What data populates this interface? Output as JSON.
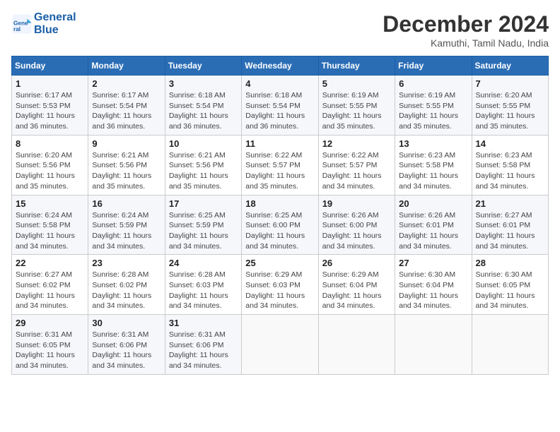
{
  "header": {
    "logo_line1": "General",
    "logo_line2": "Blue",
    "month": "December 2024",
    "location": "Kamuthi, Tamil Nadu, India"
  },
  "weekdays": [
    "Sunday",
    "Monday",
    "Tuesday",
    "Wednesday",
    "Thursday",
    "Friday",
    "Saturday"
  ],
  "weeks": [
    [
      {
        "day": "1",
        "sunrise": "6:17 AM",
        "sunset": "5:53 PM",
        "daylight": "11 hours and 36 minutes."
      },
      {
        "day": "2",
        "sunrise": "6:17 AM",
        "sunset": "5:54 PM",
        "daylight": "11 hours and 36 minutes."
      },
      {
        "day": "3",
        "sunrise": "6:18 AM",
        "sunset": "5:54 PM",
        "daylight": "11 hours and 36 minutes."
      },
      {
        "day": "4",
        "sunrise": "6:18 AM",
        "sunset": "5:54 PM",
        "daylight": "11 hours and 36 minutes."
      },
      {
        "day": "5",
        "sunrise": "6:19 AM",
        "sunset": "5:55 PM",
        "daylight": "11 hours and 35 minutes."
      },
      {
        "day": "6",
        "sunrise": "6:19 AM",
        "sunset": "5:55 PM",
        "daylight": "11 hours and 35 minutes."
      },
      {
        "day": "7",
        "sunrise": "6:20 AM",
        "sunset": "5:55 PM",
        "daylight": "11 hours and 35 minutes."
      }
    ],
    [
      {
        "day": "8",
        "sunrise": "6:20 AM",
        "sunset": "5:56 PM",
        "daylight": "11 hours and 35 minutes."
      },
      {
        "day": "9",
        "sunrise": "6:21 AM",
        "sunset": "5:56 PM",
        "daylight": "11 hours and 35 minutes."
      },
      {
        "day": "10",
        "sunrise": "6:21 AM",
        "sunset": "5:56 PM",
        "daylight": "11 hours and 35 minutes."
      },
      {
        "day": "11",
        "sunrise": "6:22 AM",
        "sunset": "5:57 PM",
        "daylight": "11 hours and 35 minutes."
      },
      {
        "day": "12",
        "sunrise": "6:22 AM",
        "sunset": "5:57 PM",
        "daylight": "11 hours and 34 minutes."
      },
      {
        "day": "13",
        "sunrise": "6:23 AM",
        "sunset": "5:58 PM",
        "daylight": "11 hours and 34 minutes."
      },
      {
        "day": "14",
        "sunrise": "6:23 AM",
        "sunset": "5:58 PM",
        "daylight": "11 hours and 34 minutes."
      }
    ],
    [
      {
        "day": "15",
        "sunrise": "6:24 AM",
        "sunset": "5:58 PM",
        "daylight": "11 hours and 34 minutes."
      },
      {
        "day": "16",
        "sunrise": "6:24 AM",
        "sunset": "5:59 PM",
        "daylight": "11 hours and 34 minutes."
      },
      {
        "day": "17",
        "sunrise": "6:25 AM",
        "sunset": "5:59 PM",
        "daylight": "11 hours and 34 minutes."
      },
      {
        "day": "18",
        "sunrise": "6:25 AM",
        "sunset": "6:00 PM",
        "daylight": "11 hours and 34 minutes."
      },
      {
        "day": "19",
        "sunrise": "6:26 AM",
        "sunset": "6:00 PM",
        "daylight": "11 hours and 34 minutes."
      },
      {
        "day": "20",
        "sunrise": "6:26 AM",
        "sunset": "6:01 PM",
        "daylight": "11 hours and 34 minutes."
      },
      {
        "day": "21",
        "sunrise": "6:27 AM",
        "sunset": "6:01 PM",
        "daylight": "11 hours and 34 minutes."
      }
    ],
    [
      {
        "day": "22",
        "sunrise": "6:27 AM",
        "sunset": "6:02 PM",
        "daylight": "11 hours and 34 minutes."
      },
      {
        "day": "23",
        "sunrise": "6:28 AM",
        "sunset": "6:02 PM",
        "daylight": "11 hours and 34 minutes."
      },
      {
        "day": "24",
        "sunrise": "6:28 AM",
        "sunset": "6:03 PM",
        "daylight": "11 hours and 34 minutes."
      },
      {
        "day": "25",
        "sunrise": "6:29 AM",
        "sunset": "6:03 PM",
        "daylight": "11 hours and 34 minutes."
      },
      {
        "day": "26",
        "sunrise": "6:29 AM",
        "sunset": "6:04 PM",
        "daylight": "11 hours and 34 minutes."
      },
      {
        "day": "27",
        "sunrise": "6:30 AM",
        "sunset": "6:04 PM",
        "daylight": "11 hours and 34 minutes."
      },
      {
        "day": "28",
        "sunrise": "6:30 AM",
        "sunset": "6:05 PM",
        "daylight": "11 hours and 34 minutes."
      }
    ],
    [
      {
        "day": "29",
        "sunrise": "6:31 AM",
        "sunset": "6:05 PM",
        "daylight": "11 hours and 34 minutes."
      },
      {
        "day": "30",
        "sunrise": "6:31 AM",
        "sunset": "6:06 PM",
        "daylight": "11 hours and 34 minutes."
      },
      {
        "day": "31",
        "sunrise": "6:31 AM",
        "sunset": "6:06 PM",
        "daylight": "11 hours and 34 minutes."
      },
      null,
      null,
      null,
      null
    ]
  ]
}
